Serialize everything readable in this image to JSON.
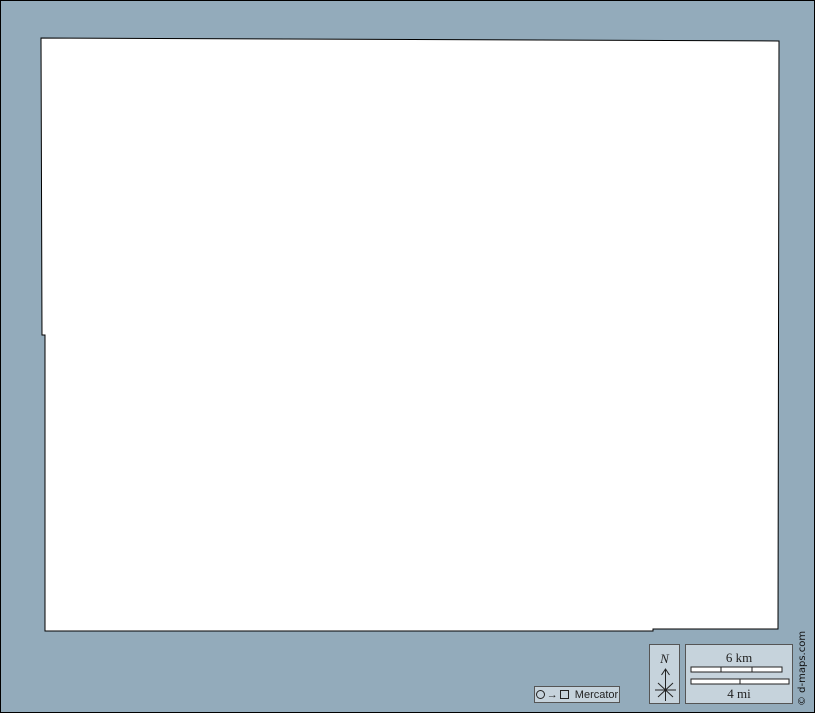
{
  "map": {
    "background_color": "#93abbb",
    "land_color": "#ffffff",
    "region_label": ""
  },
  "projection": {
    "label": "Mercator",
    "arrow": "→"
  },
  "north_arrow": {
    "letter": "N"
  },
  "scale_bar": {
    "km_label": "6 km",
    "mi_label": "4 mi"
  },
  "credit": {
    "text": "© d-maps.com"
  }
}
